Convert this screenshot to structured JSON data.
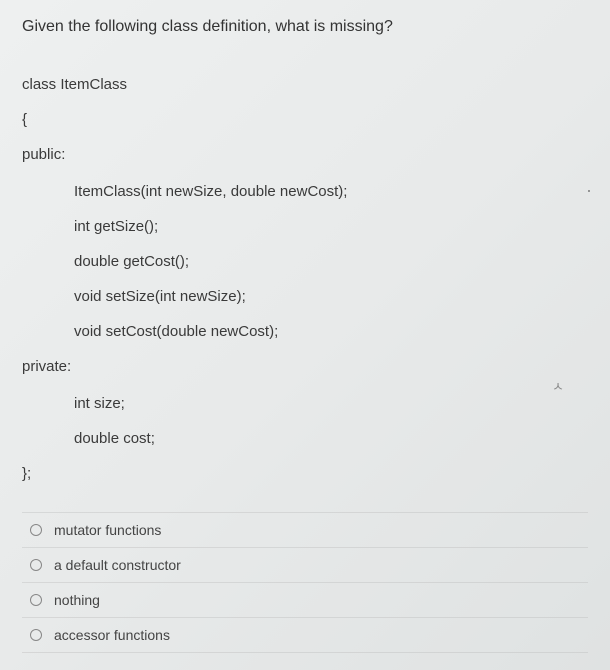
{
  "question": "Given the following class definition, what is missing?",
  "code": {
    "l1": "class ItemClass",
    "l2": "{",
    "l3": "public:",
    "l4": "ItemClass(int newSize, double newCost);",
    "l5": "int getSize();",
    "l6": "double getCost();",
    "l7": "void setSize(int newSize);",
    "l8": "void setCost(double newCost);",
    "l9": "private:",
    "l10": "int size;",
    "l11": "double cost;",
    "l12": "};"
  },
  "options": [
    {
      "label": "mutator functions"
    },
    {
      "label": "a default constructor"
    },
    {
      "label": "nothing"
    },
    {
      "label": "accessor functions"
    }
  ]
}
